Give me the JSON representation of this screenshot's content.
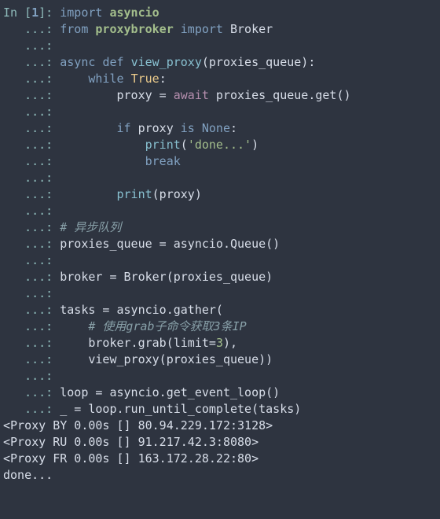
{
  "prompt": {
    "in_label": "In [",
    "in_num": "1",
    "in_close": "]: ",
    "cont": "   ...: "
  },
  "code": {
    "l01_import": "import",
    "l01_asyncio": "asyncio",
    "l02_from": "from",
    "l02_proxybroker": "proxybroker",
    "l02_import": "import",
    "l02_broker": "Broker",
    "l04_async": "async",
    "l04_def": "def",
    "l04_fn": "view_proxy",
    "l04_arg": "(proxies_queue):",
    "l05_while": "while",
    "l05_true": "True",
    "l05_colon": ":",
    "l06_indent": "        proxy = ",
    "l06_await": "await",
    "l06_rest": " proxies_queue.get()",
    "l08_if": "if",
    "l08_rest1": " proxy ",
    "l08_is": "is",
    "l08_none": "None",
    "l08_colon": ":",
    "l09_print": "print",
    "l09_str": "'done...'",
    "l10_break": "break",
    "l12_print": "print",
    "l12_arg": "(proxy)",
    "c14": "# 异步队列",
    "l15": "proxies_queue = asyncio.Queue()",
    "l17": "broker = Broker(proxies_queue)",
    "l19": "tasks = asyncio.gather(",
    "c20": "# 使用grab子命令获取3条IP",
    "l21_a": "    broker.grab(limit=",
    "l21_num": "3",
    "l21_b": "),",
    "l22": "    view_proxy(proxies_queue))",
    "l24": "loop = asyncio.get_event_loop()",
    "l25": "_ = loop.run_until_complete(tasks)"
  },
  "output": {
    "o1": "<Proxy BY 0.00s [] 80.94.229.172:3128>",
    "o2": "<Proxy RU 0.00s [] 91.217.42.3:8080>",
    "o3": "<Proxy FR 0.00s [] 163.172.28.22:80>",
    "o4": "done..."
  }
}
